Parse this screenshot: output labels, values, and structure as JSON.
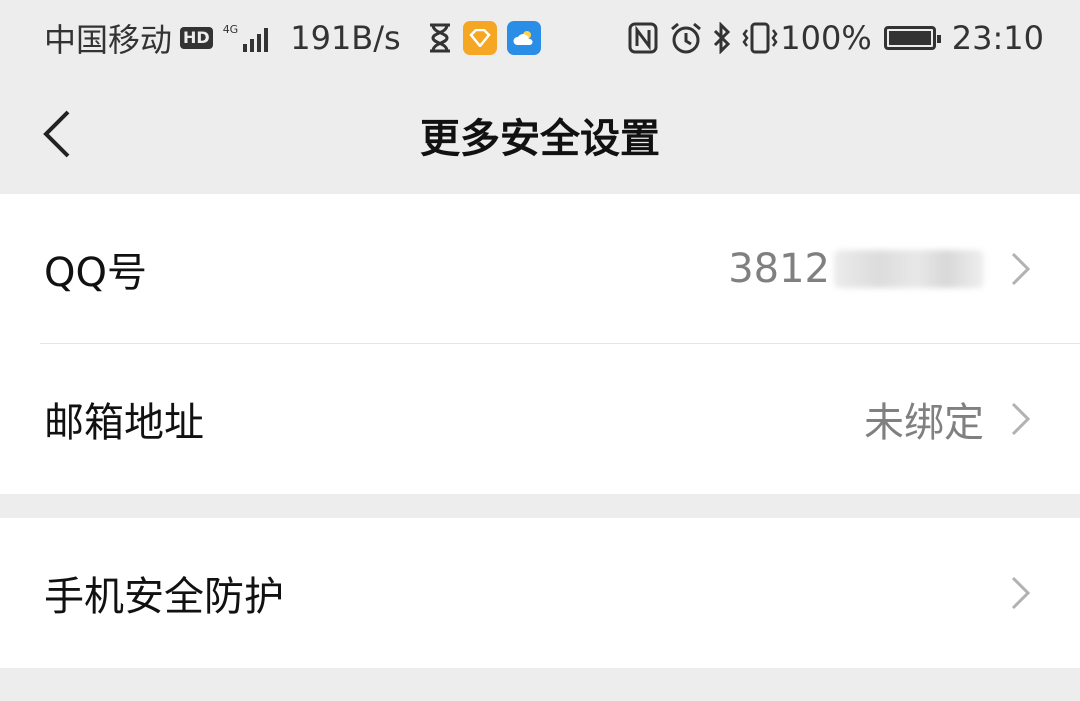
{
  "status_bar": {
    "carrier": "中国移动",
    "hd_badge": "HD",
    "network": "4G",
    "speed": "191B/s",
    "battery": "100%",
    "time": "23:10",
    "icons": [
      "hd-icon",
      "signal-icon",
      "hourglass-icon",
      "app-diamond-icon",
      "weather-icon",
      "nfc-icon",
      "alarm-icon",
      "bluetooth-icon",
      "vibrate-icon",
      "battery-icon"
    ]
  },
  "nav": {
    "title": "更多安全设置",
    "back_icon": "back-icon"
  },
  "settings": {
    "qq": {
      "label": "QQ号",
      "value": "3812"
    },
    "email": {
      "label": "邮箱地址",
      "value": "未绑定"
    },
    "phone_protect": {
      "label": "手机安全防护"
    }
  },
  "colors": {
    "background": "#ededed",
    "card": "#ffffff",
    "secondary_text": "#808080",
    "hourglass_app": "#f5a623",
    "weather_app": "#2a8ee6"
  }
}
